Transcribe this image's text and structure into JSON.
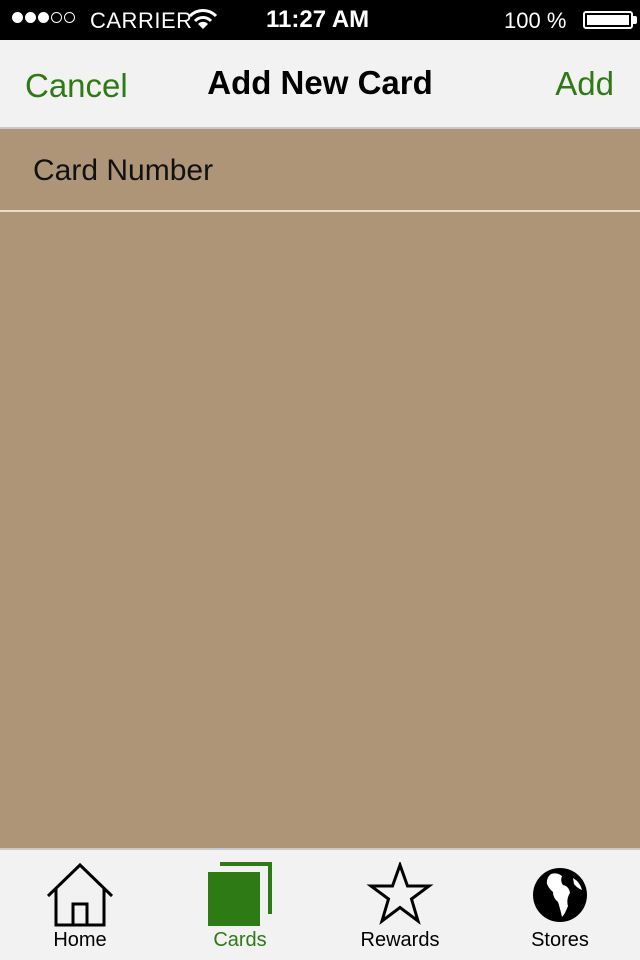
{
  "status_bar": {
    "carrier": "CARRIER",
    "time": "11:27 AM",
    "battery_percent": "100 %",
    "signal_strength": 3,
    "signal_max": 5
  },
  "nav": {
    "cancel_label": "Cancel",
    "title": "Add New Card",
    "add_label": "Add"
  },
  "form": {
    "card_number_placeholder": "Card Number",
    "card_number_value": ""
  },
  "tabs": [
    {
      "label": "Home",
      "icon": "home-icon",
      "active": false
    },
    {
      "label": "Cards",
      "icon": "cards-icon",
      "active": true
    },
    {
      "label": "Rewards",
      "icon": "star-icon",
      "active": false
    },
    {
      "label": "Stores",
      "icon": "globe-icon",
      "active": false
    }
  ],
  "colors": {
    "accent": "#2e7a14",
    "background": "#af9577",
    "bar_background": "#f2f2f2"
  }
}
